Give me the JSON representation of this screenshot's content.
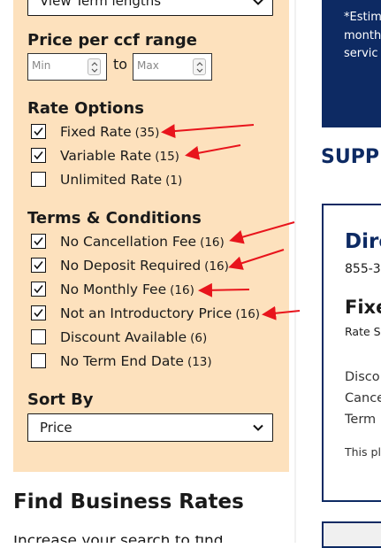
{
  "filters": {
    "term_select_value": "View Term lengths",
    "price_range": {
      "heading": "Price per ccf range",
      "min_placeholder": "Min",
      "max_placeholder": "Max",
      "separator": "to"
    },
    "rate_options": {
      "heading": "Rate Options",
      "items": [
        {
          "label": "Fixed Rate",
          "count": "(35)",
          "checked": true
        },
        {
          "label": "Variable Rate",
          "count": "(15)",
          "checked": true
        },
        {
          "label": "Unlimited Rate",
          "count": "(1)",
          "checked": false
        }
      ]
    },
    "terms": {
      "heading": "Terms & Conditions",
      "items": [
        {
          "label": "No Cancellation Fee",
          "count": "(16)",
          "checked": true
        },
        {
          "label": "No Deposit Required",
          "count": "(16)",
          "checked": true
        },
        {
          "label": "No Monthly Fee",
          "count": "(16)",
          "checked": true
        },
        {
          "label": "Not an Introductory Price",
          "count": "(16)",
          "checked": true
        },
        {
          "label": "Discount Available",
          "count": "(6)",
          "checked": false
        },
        {
          "label": "No Term End Date",
          "count": "(13)",
          "checked": false
        }
      ]
    },
    "sort": {
      "heading": "Sort By",
      "value": "Price"
    }
  },
  "find_business": {
    "heading": "Find Business Rates",
    "partial_text": "Increase your search to find"
  },
  "estimate_box": {
    "lines": [
      "*Estim",
      "month",
      "servic"
    ]
  },
  "supplier_heading": "SUPP",
  "card": {
    "title": "Dire",
    "phone": "855-3",
    "rate_title": "Fixe",
    "rate_sub": "Rate S",
    "lines": [
      "Disco",
      "Cance",
      "Term"
    ],
    "note": "This pl"
  },
  "colors": {
    "sidebar_bg": "#fde1bd",
    "navy": "#0d2a63",
    "arrow": "#e8141c"
  }
}
